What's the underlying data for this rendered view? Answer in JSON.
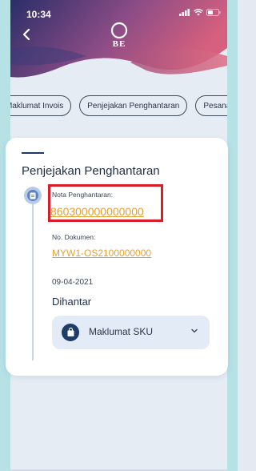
{
  "status_bar": {
    "time": "10:34"
  },
  "header": {
    "brand": "BE"
  },
  "chips": [
    "Maklumat Invois",
    "Penjejakan Penghantaran",
    "Pesanan Te"
  ],
  "card": {
    "title": "Penjejakan Penghantaran",
    "delivery_note_label": "Nota Penghantaran:",
    "delivery_note_value": "860300000000000",
    "document_no_label": "No. Dokumen:",
    "document_no_value": "MYW1-OS2100000000",
    "date": "09-04-2021",
    "status": "Dihantar",
    "sku_label": "Maklumat SKU"
  },
  "colors": {
    "link": "#e0a132",
    "highlight": "#d91e2a",
    "primary": "#1f3b68",
    "header_gradient": [
      "#2b2f6a",
      "#a24a7a",
      "#d7617f"
    ]
  },
  "icons": [
    "back-arrow-icon",
    "signal-icon",
    "wifi-icon",
    "battery-icon",
    "document-icon",
    "shopping-bag-icon",
    "chevron-down-icon"
  ]
}
